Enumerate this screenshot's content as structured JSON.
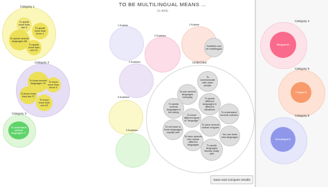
{
  "header": {
    "title": "TO BE MULTILINGUAL MEANS ...",
    "subtitle": "(n=593)"
  },
  "categories": {
    "cat1": {
      "label": "Category 1",
      "items": [
        "To speak more than two 9",
        "To speak more than three 1",
        "To speak several languages 88",
        "To speak more than one 21"
      ]
    },
    "cat2": {
      "label": "Category 2",
      "items": [
        "To know several languages 76",
        "To know more than three 9",
        "To know more than two 37",
        "To know more than one 63"
      ]
    },
    "cat3": {
      "label": "Category 3",
      "items": [
        "To understand several languages 17"
      ]
    },
    "cat4": {
      "label": "Category 4",
      "items": [
        "Bilingual 60"
      ]
    },
    "cat5": {
      "label": "Category 5",
      "items": [
        "Polyglot 8"
      ]
    },
    "cat6": {
      "label": "Category 6",
      "items": [
        "Monolingual 6"
      ]
    }
  },
  "bubbles": [
    {
      "label": "1 Bubble"
    },
    {
      "label": "2 Bubbles"
    },
    {
      "label": "1 Bubble"
    },
    {
      "label": "2 Bubbles"
    },
    {
      "label": "3 Bubbles"
    },
    {
      "label": "3 Bubbles"
    }
  ],
  "bubble_items": {
    "societies": "Societies can be multilingual"
  },
  "undecided": {
    "label": "Undecided",
    "items": [
      "To communicate with other people",
      "To use several languages everyday",
      "To speak different languages in different situations",
      "To speak several languages in the family",
      "To understand several cultures",
      "To know different types of \"language\"",
      "To have several mother tongues",
      "To not have to know languages equally well",
      "To have parents who speak different languages",
      "You can learn new languages",
      "To speak languages fluently really well"
    ]
  },
  "actions": {
    "save": "Save and compare results"
  },
  "colors": {
    "cat1": "#fbf7b9",
    "cat2": "#e6def5",
    "cat3": "#dff7d8",
    "cat4": "#f96a8c",
    "cat5": "#f89a6c",
    "cat6": "#8f97ea"
  }
}
